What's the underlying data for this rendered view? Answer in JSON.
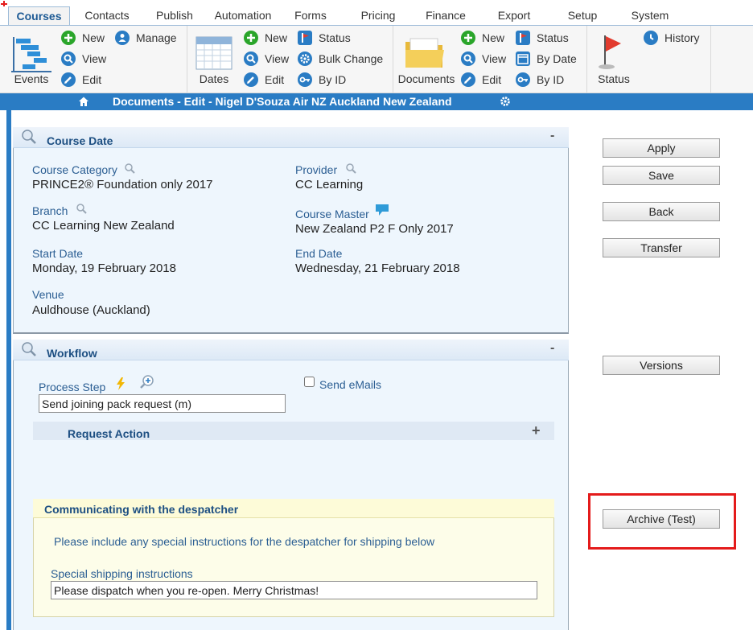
{
  "tabs": [
    "Courses",
    "Contacts",
    "Publish",
    "Automation",
    "Forms",
    "Pricing",
    "Finance",
    "Export",
    "Setup",
    "System"
  ],
  "ribbon": {
    "events": {
      "label": "Events",
      "new": "New",
      "view": "View",
      "edit": "Edit",
      "manage": "Manage"
    },
    "dates": {
      "label": "Dates",
      "new": "New",
      "view": "View",
      "edit": "Edit",
      "status": "Status",
      "bulk_change": "Bulk Change",
      "by_id": "By ID"
    },
    "documents": {
      "label": "Documents",
      "new": "New",
      "view": "View",
      "edit": "Edit",
      "status": "Status",
      "by_date": "By Date",
      "by_id": "By ID"
    },
    "status": {
      "label": "Status",
      "history": "History"
    }
  },
  "page_title": "Documents - Edit - Nigel D'Souza Air NZ Auckland New Zealand",
  "course_date": {
    "title": "Course Date",
    "collapse": "-",
    "course_category_label": "Course Category",
    "course_category": "PRINCE2® Foundation only 2017",
    "provider_label": "Provider",
    "provider": "CC Learning",
    "branch_label": "Branch",
    "branch": "CC Learning New Zealand",
    "course_master_label": "Course Master",
    "course_master": "New Zealand P2 F Only 2017",
    "start_date_label": "Start Date",
    "start_date": "Monday, 19 February 2018",
    "end_date_label": "End Date",
    "end_date": "Wednesday, 21 February 2018",
    "venue_label": "Venue",
    "venue": "Auldhouse (Auckland)"
  },
  "workflow": {
    "title": "Workflow",
    "collapse": "-",
    "process_step_label": "Process Step",
    "process_step_value": "Send joining pack request (m)",
    "send_emails_label": "Send eMails",
    "request_action": "Request Action",
    "expand": "+",
    "despatcher": {
      "title": "Communicating with the despatcher",
      "instructions": "Please include any special instructions for the despatcher for shipping below",
      "shipping_label": "Special shipping instructions",
      "shipping_value": "Please dispatch when you re-open. Merry Christmas!"
    }
  },
  "buttons": {
    "apply": "Apply",
    "save": "Save",
    "back": "Back",
    "transfer": "Transfer",
    "versions": "Versions",
    "archive": "Archive (Test)"
  }
}
